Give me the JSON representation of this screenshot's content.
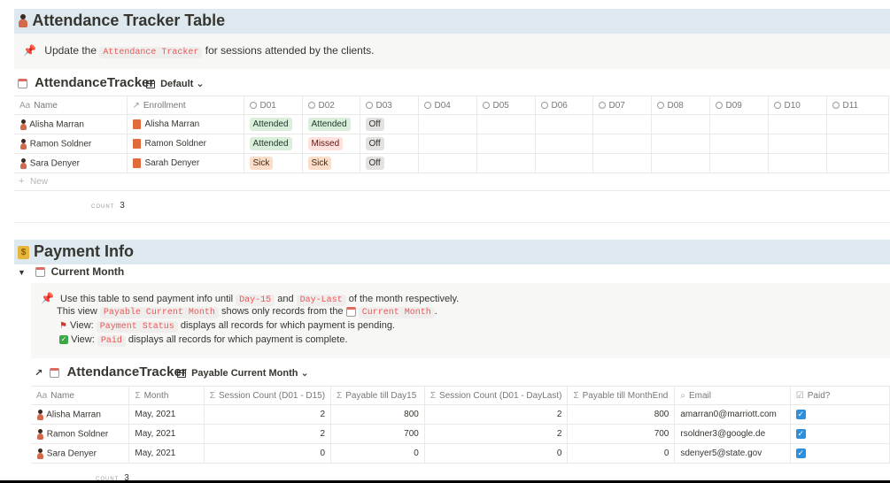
{
  "attendance_section": {
    "title": "Attendance Tracker Table",
    "callout": {
      "prefix": "Update the",
      "code": "Attendance Tracker",
      "suffix": "for sessions attended by the clients."
    },
    "db_title": "AttendanceTracker",
    "view_label": "Default",
    "columns": [
      "Name",
      "Enrollment",
      "D01",
      "D02",
      "D03",
      "D04",
      "D05",
      "D06",
      "D07",
      "D08",
      "D09",
      "D10",
      "D11"
    ],
    "rows": [
      {
        "name": "Alisha Marran",
        "enrollment": "Alisha Marran",
        "d01": "Attended",
        "d02": "Attended",
        "d03": "Off"
      },
      {
        "name": "Ramon Soldner",
        "enrollment": "Ramon Soldner",
        "d01": "Attended",
        "d02": "Missed",
        "d03": "Off"
      },
      {
        "name": "Sara Denyer",
        "enrollment": "Sarah Denyer",
        "d01": "Sick",
        "d02": "Sick",
        "d03": "Off"
      }
    ],
    "new_label": "New",
    "count_label": "COUNT",
    "count_value": "3"
  },
  "payment_section": {
    "title": "Payment Info",
    "toggle_title": "Current Month",
    "callout": {
      "line1_prefix": "Use this table to send payment info until",
      "line1_code1": "Day-15",
      "line1_and": "and",
      "line1_code2": "Day-Last",
      "line1_suffix": "of the month respectively.",
      "line2_prefix": "This view",
      "line2_code": "Payable Current Month",
      "line2_mid": "shows only records from the",
      "line2_link": "Current Month",
      "line2_end": ".",
      "line3_prefix": "View:",
      "line3_code": "Payment Status",
      "line3_suffix": "displays all records for which payment is pending.",
      "line4_prefix": "View:",
      "line4_code": "Paid",
      "line4_suffix": "displays all records for which payment is complete."
    },
    "db_title": "AttendanceTracker",
    "view_label": "Payable Current Month",
    "columns": [
      "Name",
      "Month",
      "Session Count (D01 - D15)",
      "Payable till Day15",
      "Session Count (D01 - DayLast)",
      "Payable till MonthEnd",
      "Email",
      "Paid?"
    ],
    "rows": [
      {
        "name": "Alisha Marran",
        "month": "May, 2021",
        "sc15": "2",
        "pay15": "800",
        "sclast": "2",
        "paylast": "800",
        "email": "amarran0@marriott.com",
        "paid": true
      },
      {
        "name": "Ramon Soldner",
        "month": "May, 2021",
        "sc15": "2",
        "pay15": "700",
        "sclast": "2",
        "paylast": "700",
        "email": "rsoldner3@google.de",
        "paid": true
      },
      {
        "name": "Sara Denyer",
        "month": "May, 2021",
        "sc15": "0",
        "pay15": "0",
        "sclast": "0",
        "paylast": "0",
        "email": "sdenyer5@state.gov",
        "paid": true
      }
    ],
    "count_label": "COUNT",
    "count_value": "3"
  },
  "colors": {
    "header_band": "#dde9ef",
    "callout_bg": "#f7f7f5",
    "code_text": "#eb5757",
    "checkbox": "#2e8fdc"
  }
}
